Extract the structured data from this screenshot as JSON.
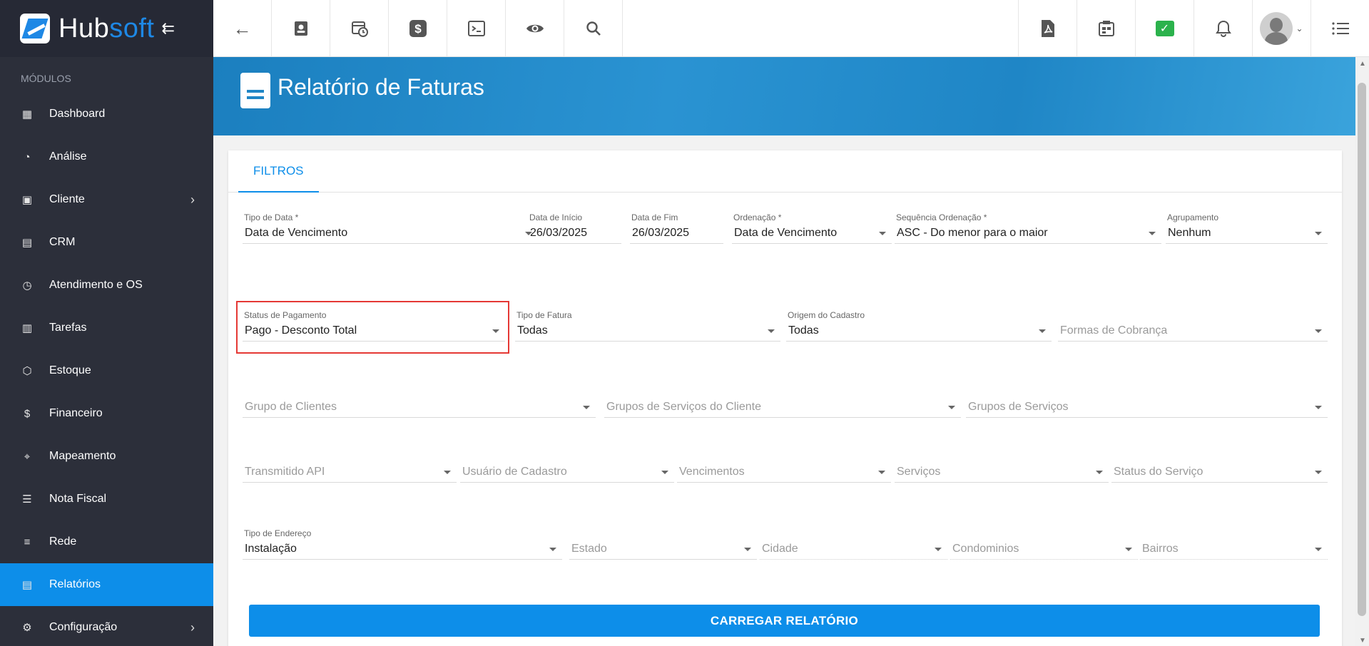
{
  "brand": {
    "name_part1": "Hub",
    "name_part2": "soft"
  },
  "sidebar": {
    "section_label": "MÓDULOS",
    "items": [
      {
        "label": "Dashboard",
        "icon": "dashboard-icon"
      },
      {
        "label": "Análise",
        "icon": "pie-chart-icon"
      },
      {
        "label": "Cliente",
        "icon": "contact-card-icon",
        "chevron": "›"
      },
      {
        "label": "CRM",
        "icon": "crm-icon"
      },
      {
        "label": "Atendimento e OS",
        "icon": "calendar-clock-icon"
      },
      {
        "label": "Tarefas",
        "icon": "tasks-icon"
      },
      {
        "label": "Estoque",
        "icon": "box-icon"
      },
      {
        "label": "Financeiro",
        "icon": "money-icon"
      },
      {
        "label": "Mapeamento",
        "icon": "map-pin-icon"
      },
      {
        "label": "Nota Fiscal",
        "icon": "receipt-icon"
      },
      {
        "label": "Rede",
        "icon": "server-icon"
      },
      {
        "label": "Relatórios",
        "icon": "report-icon"
      },
      {
        "label": "Configuração",
        "icon": "gear-icon",
        "chevron": "›"
      }
    ]
  },
  "page": {
    "title": "Relatório de Faturas"
  },
  "tabs": {
    "filters": "FILTROS"
  },
  "filters": {
    "tipo_data": {
      "label": "Tipo de Data *",
      "value": "Data de Vencimento"
    },
    "data_inicio": {
      "label": "Data de Início",
      "value": "26/03/2025"
    },
    "data_fim": {
      "label": "Data de Fim",
      "value": "26/03/2025"
    },
    "ordenacao": {
      "label": "Ordenação *",
      "value": "Data de Vencimento"
    },
    "sequencia": {
      "label": "Sequência Ordenação *",
      "value": "ASC - Do menor para o maior"
    },
    "agrupamento": {
      "label": "Agrupamento",
      "value": "Nenhum"
    },
    "status_pagamento": {
      "label": "Status de Pagamento",
      "value": "Pago - Desconto Total"
    },
    "tipo_fatura": {
      "label": "Tipo de Fatura",
      "value": "Todas"
    },
    "origem_cadastro": {
      "label": "Origem do Cadastro",
      "value": "Todas"
    },
    "formas_cobranca": {
      "placeholder": "Formas de Cobrança"
    },
    "grupo_clientes": {
      "placeholder": "Grupo de Clientes"
    },
    "grupos_servicos_cliente": {
      "placeholder": "Grupos de Serviços do Cliente"
    },
    "grupos_servicos": {
      "placeholder": "Grupos de Serviços"
    },
    "transmitido_api": {
      "placeholder": "Transmitido API"
    },
    "usuario_cadastro": {
      "placeholder": "Usuário de Cadastro"
    },
    "vencimentos": {
      "placeholder": "Vencimentos"
    },
    "servicos": {
      "placeholder": "Serviços"
    },
    "status_servico": {
      "placeholder": "Status do Serviço"
    },
    "tipo_endereco": {
      "label": "Tipo de Endereço",
      "value": "Instalação"
    },
    "estado": {
      "placeholder": "Estado"
    },
    "cidade": {
      "placeholder": "Cidade"
    },
    "condominios": {
      "placeholder": "Condominios"
    },
    "bairros": {
      "placeholder": "Bairros"
    }
  },
  "actions": {
    "load_report": "CARREGAR RELATÓRIO"
  },
  "colors": {
    "accent": "#0d8ee9",
    "sidebar_bg": "#2c2f3a",
    "highlight": "#e53935",
    "chat_green": "#2bb24c"
  }
}
